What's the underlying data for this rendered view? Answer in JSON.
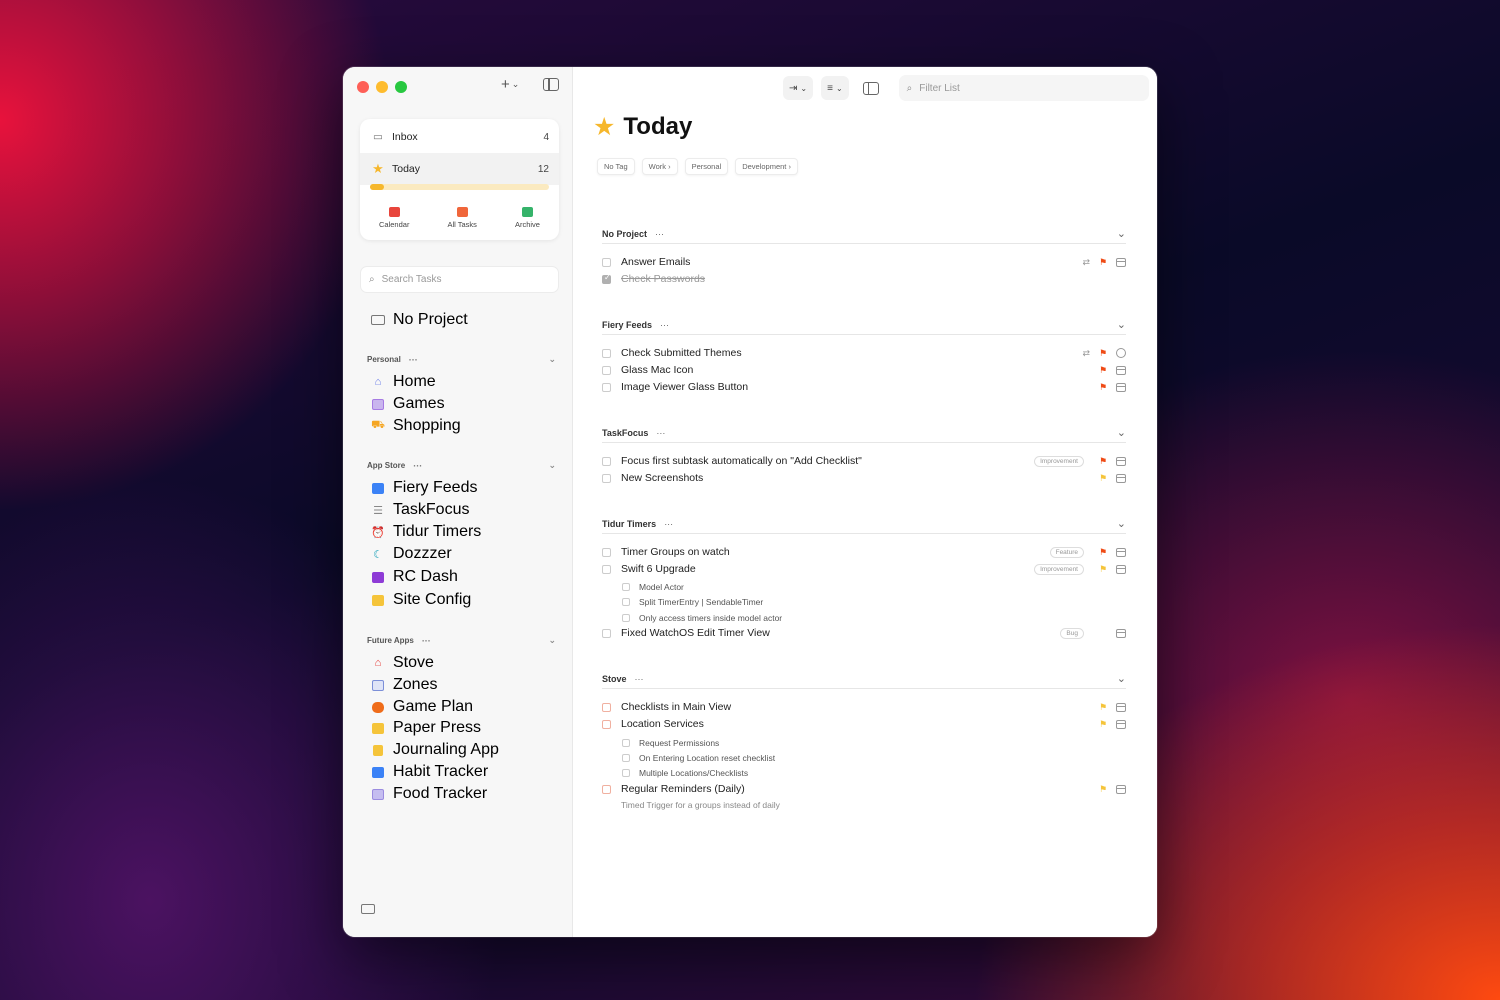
{
  "sidebar": {
    "card": {
      "inbox": {
        "label": "Inbox",
        "count": "4"
      },
      "today": {
        "label": "Today",
        "count": "12",
        "progress_pct": 8
      },
      "quick": [
        {
          "label": "Calendar",
          "icon": "calendar-icon",
          "color": "#e8453c"
        },
        {
          "label": "All Tasks",
          "icon": "all-tasks-icon",
          "color": "#f0663a"
        },
        {
          "label": "Archive",
          "icon": "archive-icon",
          "color": "#35b36a"
        }
      ]
    },
    "search_placeholder": "Search Tasks",
    "no_project": "No Project",
    "sections": [
      {
        "title": "Personal",
        "dots": "···",
        "items": [
          {
            "label": "Home",
            "icon": "house-icon",
            "color": "#6b7de8"
          },
          {
            "label": "Games",
            "icon": "games-icon",
            "color": "#a67be3"
          },
          {
            "label": "Shopping",
            "icon": "cart-icon",
            "color": "#f5a623"
          }
        ]
      },
      {
        "title": "App Store",
        "dots": "···",
        "items": [
          {
            "label": "Fiery Feeds",
            "icon": "feeds-icon",
            "color": "#3b82f6"
          },
          {
            "label": "TaskFocus",
            "icon": "list-icon",
            "color": "#888888"
          },
          {
            "label": "Tidur Timers",
            "icon": "alarm-icon",
            "color": "#ef5350"
          },
          {
            "label": "Dozzzer",
            "icon": "moon-icon",
            "color": "#1aa0b8"
          },
          {
            "label": "RC Dash",
            "icon": "chart-icon",
            "color": "#8e3bd6"
          },
          {
            "label": "Site Config",
            "icon": "config-icon",
            "color": "#f5c43a"
          }
        ]
      },
      {
        "title": "Future Apps",
        "dots": "···",
        "items": [
          {
            "label": "Stove",
            "icon": "house-icon",
            "color": "#e53935"
          },
          {
            "label": "Zones",
            "icon": "zones-icon",
            "color": "#7c8fd8"
          },
          {
            "label": "Game Plan",
            "icon": "gamepad-icon",
            "color": "#ef6c1a"
          },
          {
            "label": "Paper Press",
            "icon": "book-icon",
            "color": "#f5c43a"
          },
          {
            "label": "Journaling App",
            "icon": "journal-icon",
            "color": "#f5c43a"
          },
          {
            "label": "Habit Tracker",
            "icon": "piano-icon",
            "color": "#3b82f6"
          },
          {
            "label": "Food Tracker",
            "icon": "grid-icon",
            "color": "#9b8ce0"
          }
        ]
      }
    ]
  },
  "toolbar": {
    "filter_placeholder": "Filter List"
  },
  "main": {
    "title": "Today",
    "tags": [
      "No Tag",
      "Work ›",
      "Personal",
      "Development ›"
    ],
    "groups": [
      {
        "title": "No Project",
        "dots": "···",
        "tasks": [
          {
            "label": "Answer Emails",
            "done": false,
            "repeat": true,
            "flag": "red",
            "icon": "calendar"
          },
          {
            "label": "Check Passwords",
            "done": true
          }
        ]
      },
      {
        "title": "Fiery Feeds",
        "dots": "···",
        "tasks": [
          {
            "label": "Check Submitted Themes",
            "repeat": true,
            "flag": "red",
            "icon": "clock"
          },
          {
            "label": "Glass Mac Icon",
            "flag": "red",
            "icon": "calendar"
          },
          {
            "label": "Image Viewer Glass Button",
            "flag": "red",
            "icon": "calendar"
          }
        ]
      },
      {
        "title": "TaskFocus",
        "dots": "···",
        "tasks": [
          {
            "label": "Focus first subtask automatically on \"Add Checklist\"",
            "badge": "Improvement",
            "flag": "red",
            "icon": "calendar"
          },
          {
            "label": "New Screenshots",
            "flag": "yellow",
            "icon": "calendar"
          }
        ]
      },
      {
        "title": "Tidur Timers",
        "dots": "···",
        "tasks": [
          {
            "label": "Timer Groups on watch",
            "badge": "Feature",
            "flag": "red",
            "icon": "calendar"
          },
          {
            "label": "Swift 6 Upgrade",
            "badge": "Improvement",
            "flag": "yellow",
            "icon": "calendar"
          },
          {
            "label": "Model Actor",
            "sub": true
          },
          {
            "label": "Split TimerEntry | SendableTimer",
            "sub": true
          },
          {
            "label": "Only access timers inside model actor",
            "sub": true
          },
          {
            "label": "Fixed WatchOS Edit Timer View",
            "badge": "Bug",
            "icon": "calendar"
          }
        ]
      },
      {
        "title": "Stove",
        "dots": "···",
        "tasks": [
          {
            "label": "Checklists in Main View",
            "flag": "yellow",
            "icon": "calendar"
          },
          {
            "label": "Location Services",
            "flag": "yellow",
            "icon": "calendar"
          },
          {
            "label": "Request Permissions",
            "sub": true
          },
          {
            "label": "On Entering Location reset checklist",
            "sub": true
          },
          {
            "label": "Multiple Locations/Checklists",
            "sub": true
          },
          {
            "label": "Regular Reminders (Daily)",
            "flag": "yellow",
            "icon": "calendar"
          }
        ],
        "note": "Timed Trigger for a groups instead of daily"
      }
    ]
  }
}
